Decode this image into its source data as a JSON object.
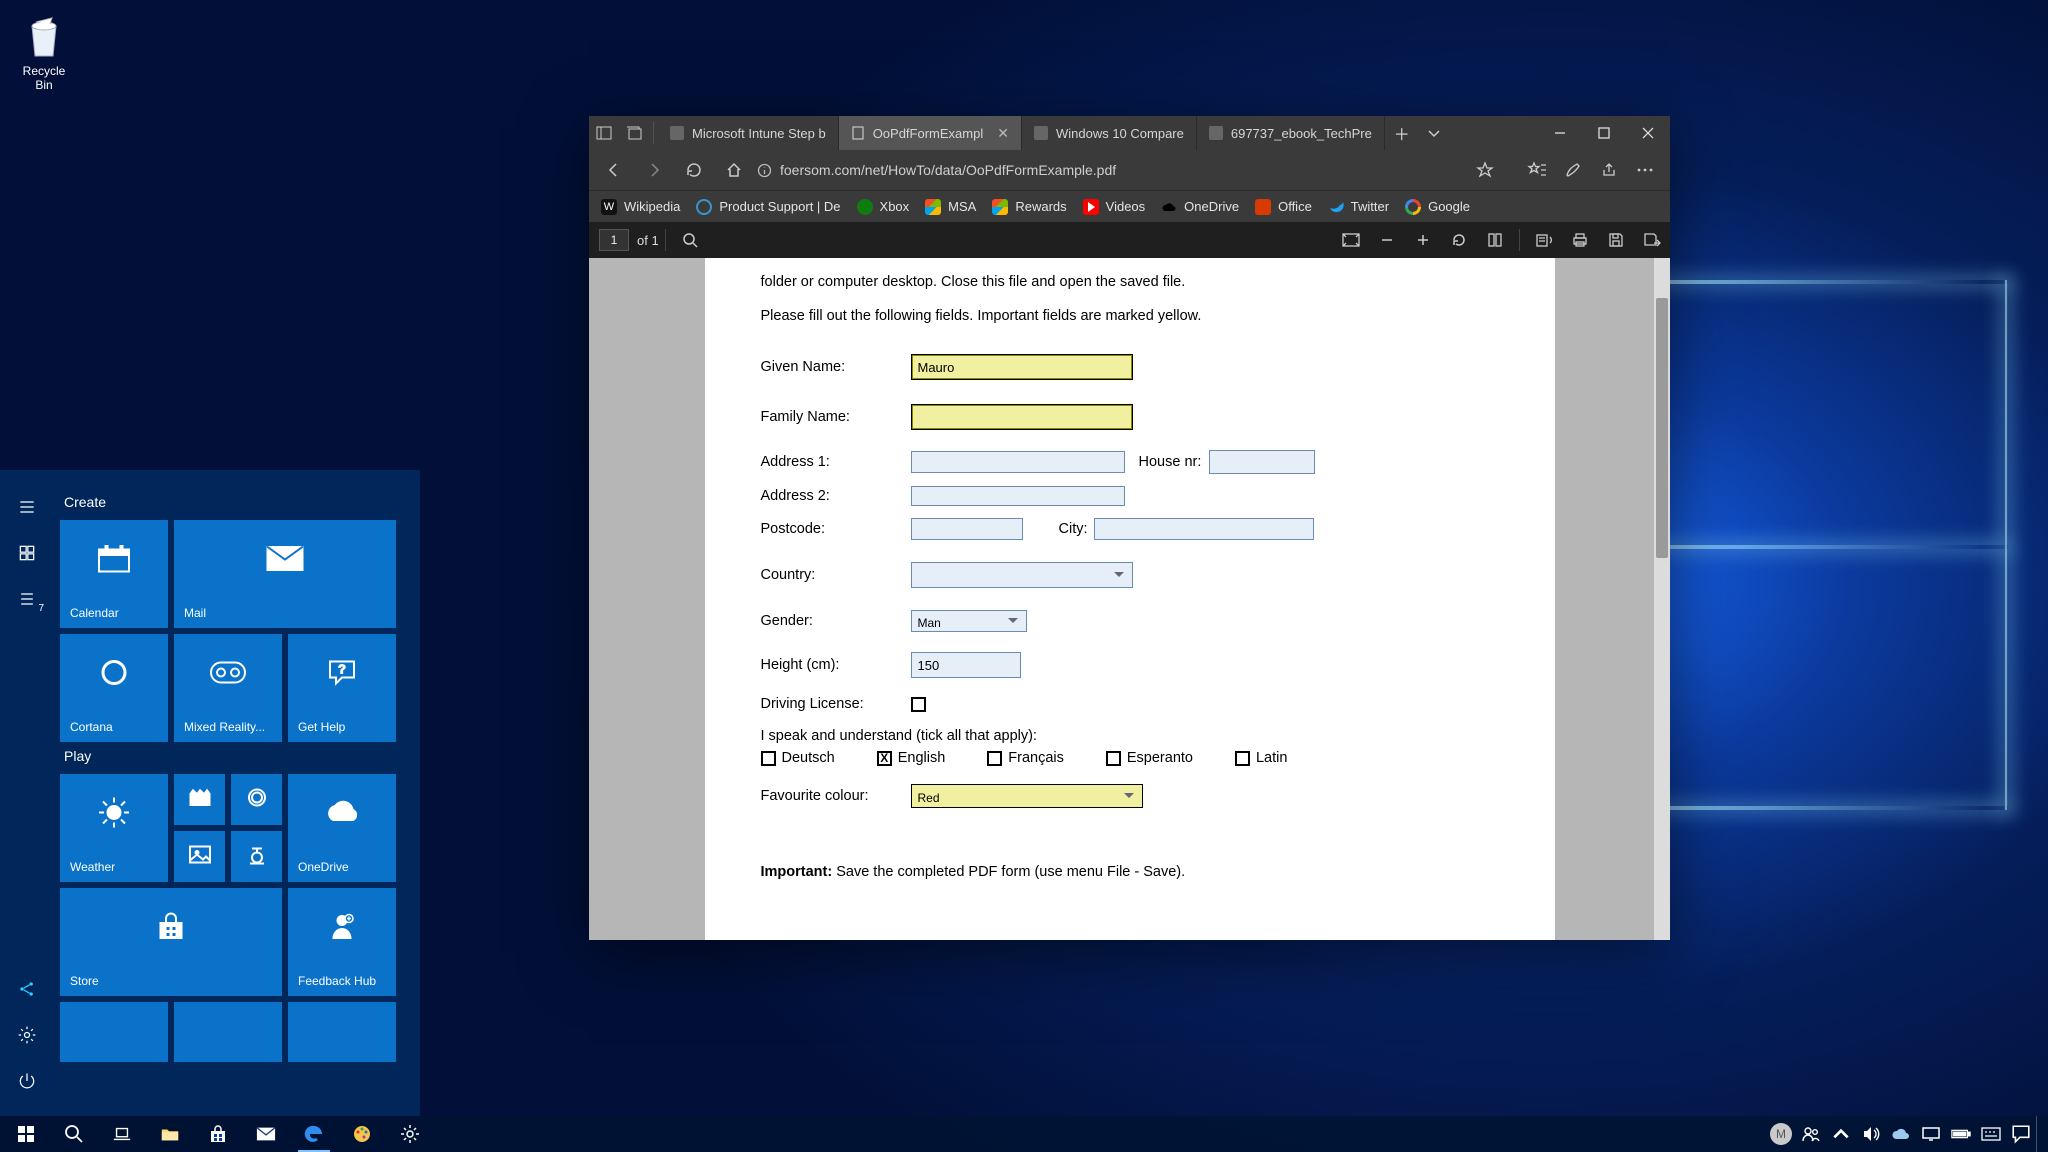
{
  "desktop": {
    "recycle_bin_label": "Recycle\nBin"
  },
  "start_menu": {
    "sections": {
      "create": "Create",
      "play": "Play"
    },
    "tiles": {
      "calendar": "Calendar",
      "mail": "Mail",
      "cortana": "Cortana",
      "mixed_reality": "Mixed Reality...",
      "get_help": "Get Help",
      "weather": "Weather",
      "onedrive": "OneDrive",
      "store": "Store",
      "feedback": "Feedback Hub"
    }
  },
  "edge": {
    "tabs": [
      {
        "label": "Microsoft Intune Step b"
      },
      {
        "label": "OoPdfFormExampl",
        "active": true
      },
      {
        "label": "Windows 10 Compare"
      },
      {
        "label": "697737_ebook_TechPre"
      }
    ],
    "url": "foersom.com/net/HowTo/data/OoPdfFormExample.pdf",
    "favorites": [
      "Wikipedia",
      "Product Support | De",
      "Xbox",
      "MSA",
      "Rewards",
      "Videos",
      "OneDrive",
      "Office",
      "Twitter",
      "Google"
    ]
  },
  "pdf_toolbar": {
    "page_current": "1",
    "page_total_prefix": "of ",
    "page_total": "1"
  },
  "pdf": {
    "text_top": "folder or computer desktop. Close this file and open the saved file.",
    "text_fill": "Please fill out the following fields. Important fields are marked yellow.",
    "labels": {
      "given_name": "Given Name:",
      "family_name": "Family Name:",
      "address1": "Address 1:",
      "address2": "Address 2:",
      "house_nr": "House nr:",
      "postcode": "Postcode:",
      "city": "City:",
      "country": "Country:",
      "gender": "Gender:",
      "height": "Height (cm):",
      "driving": "Driving License:",
      "languages_intro": "I speak and understand (tick all that apply):",
      "fav_colour": "Favourite colour:",
      "important_label": "Important:",
      "important_text": " Save the completed PDF form (use menu File - Save)."
    },
    "values": {
      "given_name": "Mauro",
      "family_name": "",
      "address1": "",
      "address2": "",
      "house_nr": "",
      "postcode": "",
      "city": "",
      "country": "",
      "gender": "Man",
      "height": "150",
      "driving_checked": false,
      "languages": {
        "deutsch": {
          "label": "Deutsch",
          "checked": false
        },
        "english": {
          "label": "English",
          "checked": true
        },
        "francais": {
          "label": "Français",
          "checked": false
        },
        "esperanto": {
          "label": "Esperanto",
          "checked": false
        },
        "latin": {
          "label": "Latin",
          "checked": false
        }
      },
      "fav_colour": "Red"
    }
  },
  "taskbar": {
    "user_initial": "M"
  }
}
